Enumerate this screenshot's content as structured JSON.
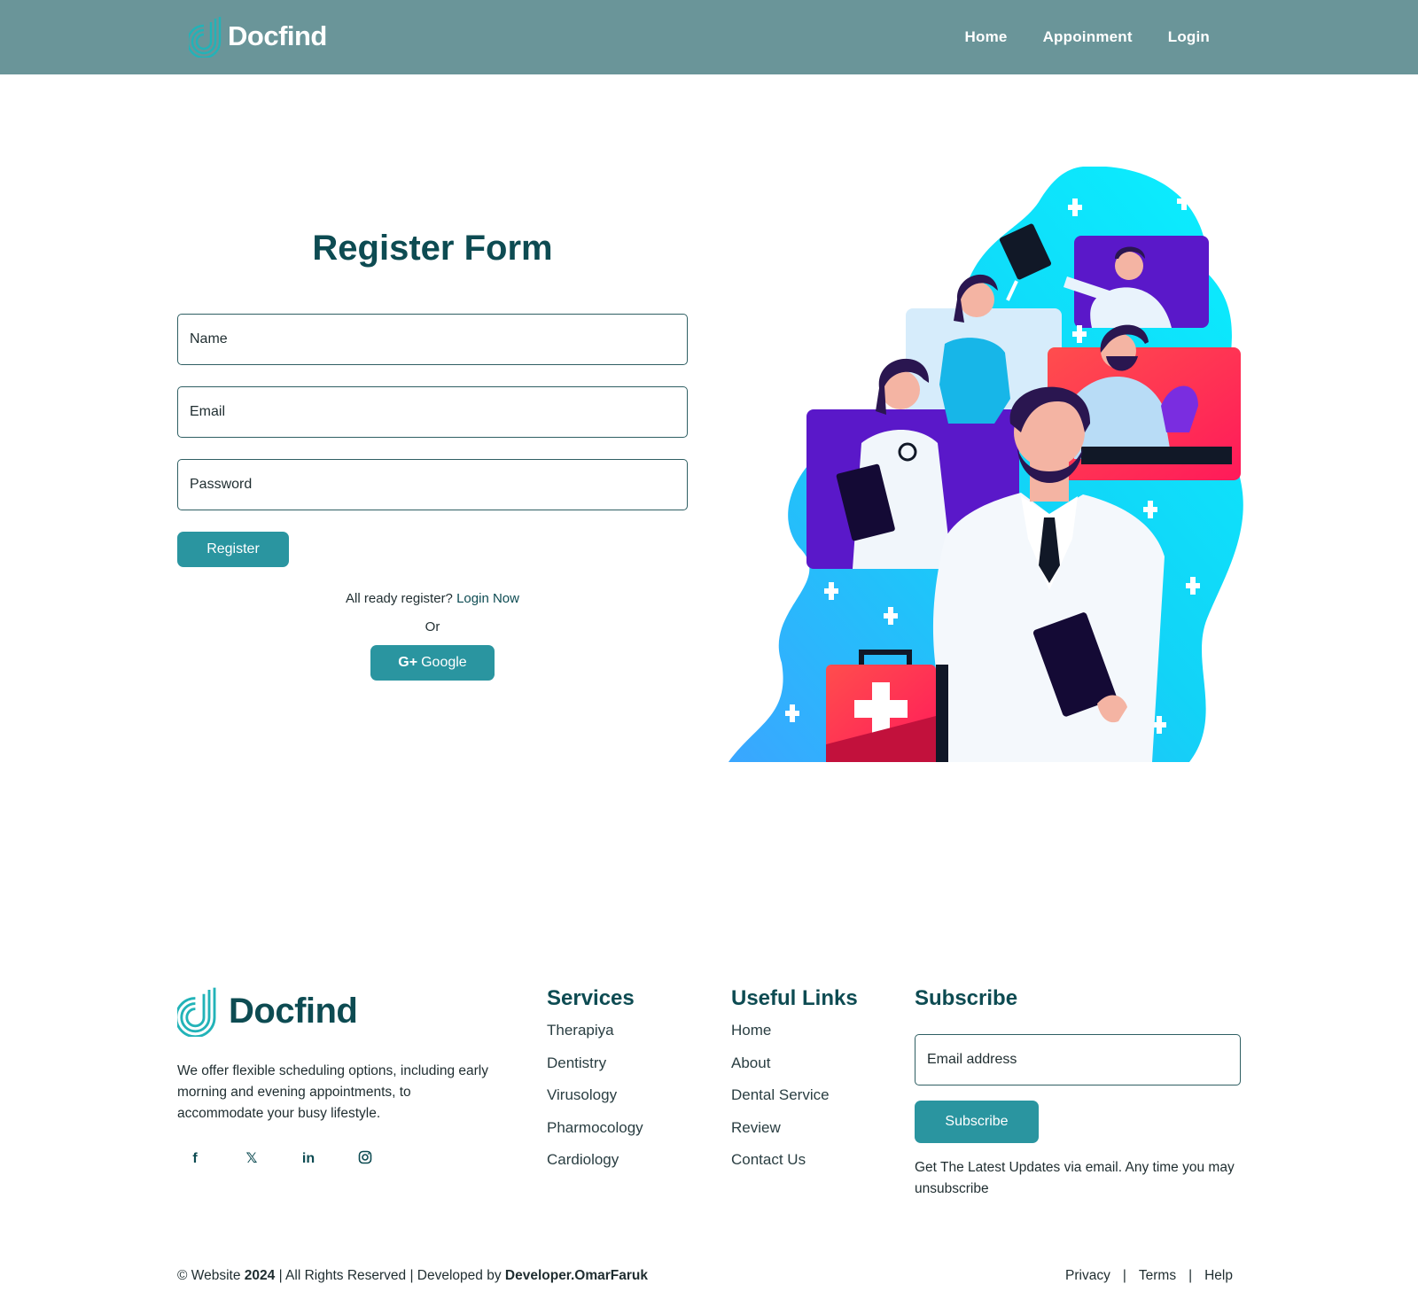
{
  "header": {
    "brand": "Docfind",
    "nav": [
      "Home",
      "Appoinment",
      "Login"
    ]
  },
  "form": {
    "title": "Register Form",
    "name_placeholder": "Name",
    "email_placeholder": "Email",
    "password_placeholder": "Password",
    "register_label": "Register",
    "already_text": "All ready register?",
    "login_link": "Login Now",
    "or_text": "Or",
    "google_label": "Google",
    "google_prefix": "G+"
  },
  "footer": {
    "brand": "Docfind",
    "about": "We offer flexible scheduling options, including early morning and evening appointments, to accommodate your busy lifestyle.",
    "socials": [
      "facebook-icon",
      "x-twitter-icon",
      "linkedin-icon",
      "instagram-icon"
    ],
    "services": {
      "title": "Services",
      "items": [
        "Therapiya",
        "Dentistry",
        "Virusology",
        "Pharmocology",
        "Cardiology"
      ]
    },
    "useful_links": {
      "title": "Useful Links",
      "items": [
        "Home",
        "About",
        "Dental Service",
        "Review",
        "Contact Us"
      ]
    },
    "subscribe": {
      "title": "Subscribe",
      "placeholder": "Email address",
      "button": "Subscribe",
      "note": "Get The Latest Updates via email. Any time you may unsubscribe"
    },
    "copyright": {
      "prefix": "© Website",
      "year": "2024",
      "middle": "| All Rights Reserved | Developed by",
      "developer": "Developer.OmarFaruk"
    },
    "legal": [
      "Privacy",
      "Terms",
      "Help"
    ]
  },
  "colors": {
    "header_bg": "#6a9599",
    "primary": "#2a95a0",
    "heading": "#0d4b52"
  }
}
